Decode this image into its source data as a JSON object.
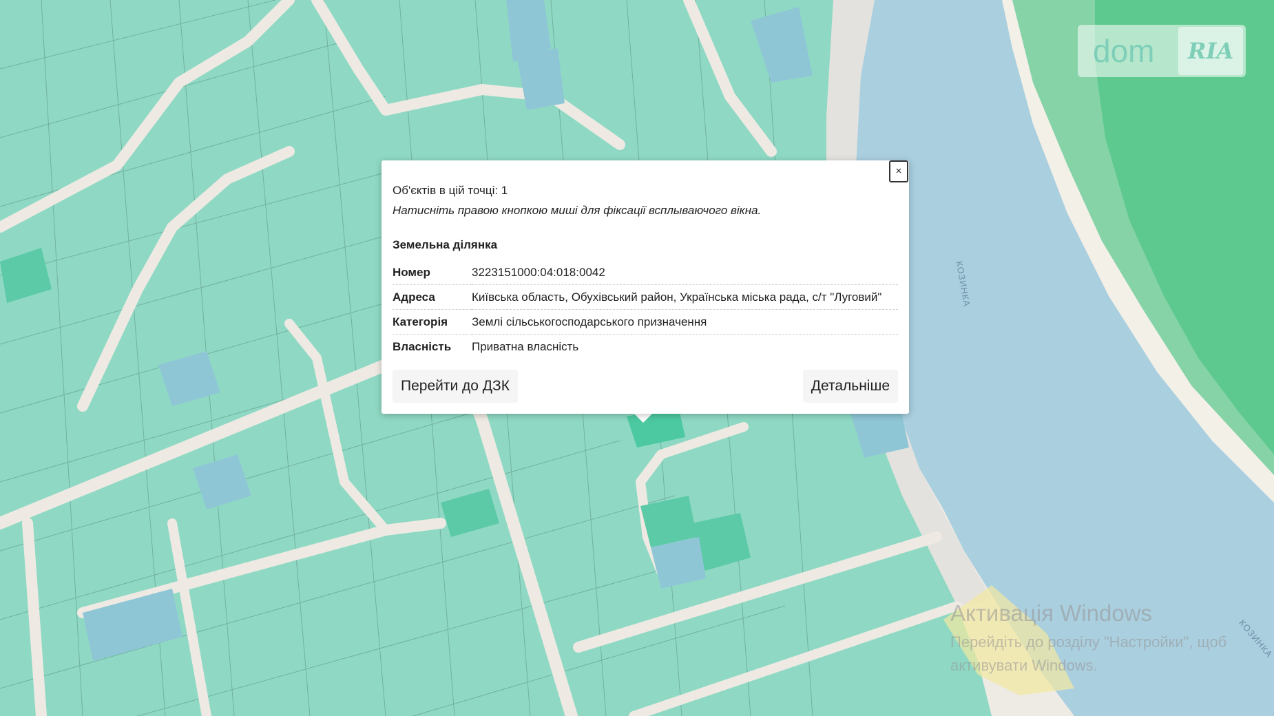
{
  "popup": {
    "close_label": "×",
    "objects_count": "Об'єктів в цій точці: 1",
    "hint": "Натисніть правою кнопкою миші для фіксації всплываючого вікна.",
    "section_title": "Земельна ділянка",
    "fields": [
      {
        "key": "Номер",
        "value": "3223151000:04:018:0042"
      },
      {
        "key": "Адреса",
        "value": "Київська область, Обухівський район, Українська міська рада, с/т \"Луговий\""
      },
      {
        "key": "Категорія",
        "value": "Землі сільськогосподарського призначення"
      },
      {
        "key": "Власність",
        "value": "Приватна власність"
      }
    ],
    "button_dzk": "Перейти до ДЗК",
    "button_details": "Детальніше"
  },
  "logo": {
    "dom": "dom",
    "ria": "RIA"
  },
  "map": {
    "river_label": "КОЗИНКА",
    "colors": {
      "parcel": "#8fd9c4",
      "parcel_dark": "#5cc9a7",
      "parcel_blue": "#8fc6d6",
      "road": "#ede9e2",
      "water": "#aacfe0",
      "forest": "#7fcf9f",
      "sand": "#f3f1ea"
    }
  },
  "watermark": {
    "title": "Активація Windows",
    "line1": "Перейдіть до розділу \"Настройки\", щоб",
    "line2": "активувати Windows."
  }
}
